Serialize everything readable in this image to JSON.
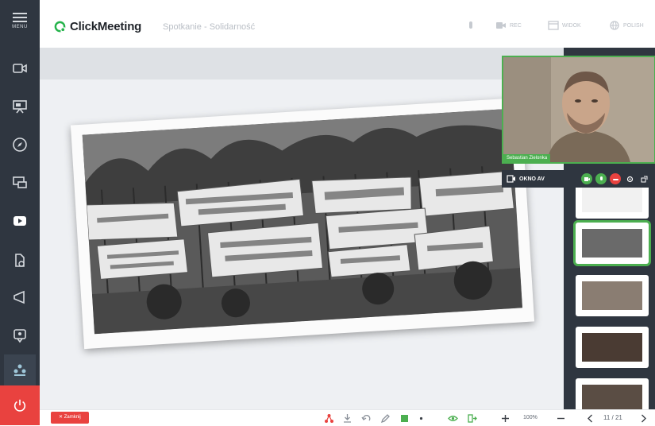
{
  "app": {
    "logo_text": "ClickMeeting",
    "meeting_title": "Spotkanie - Solidarność"
  },
  "sidebar": {
    "menu_label": "MENU",
    "items": [
      {
        "icon": "webcam-icon"
      },
      {
        "icon": "presentation-icon"
      },
      {
        "icon": "compass-icon"
      },
      {
        "icon": "screen-share-icon"
      },
      {
        "icon": "youtube-icon"
      },
      {
        "icon": "files-icon"
      },
      {
        "icon": "megaphone-icon"
      },
      {
        "icon": "poll-icon"
      },
      {
        "icon": "attendees-icon"
      }
    ],
    "leave_icon": "power-icon"
  },
  "topbar": {
    "rec_label": "REC",
    "mode_label": "WIDOK",
    "lang_label": "POLISH"
  },
  "webcam": {
    "presenter_name": "Sebastian Zielonka",
    "av_window_label": "OKNO AV"
  },
  "bottom": {
    "close_label": "✕ Zamknij",
    "zoom": "100%",
    "page": "11 / 21"
  },
  "colors": {
    "accent": "#4caf50",
    "danger": "#e9423f",
    "sidebar": "#2f3640"
  }
}
